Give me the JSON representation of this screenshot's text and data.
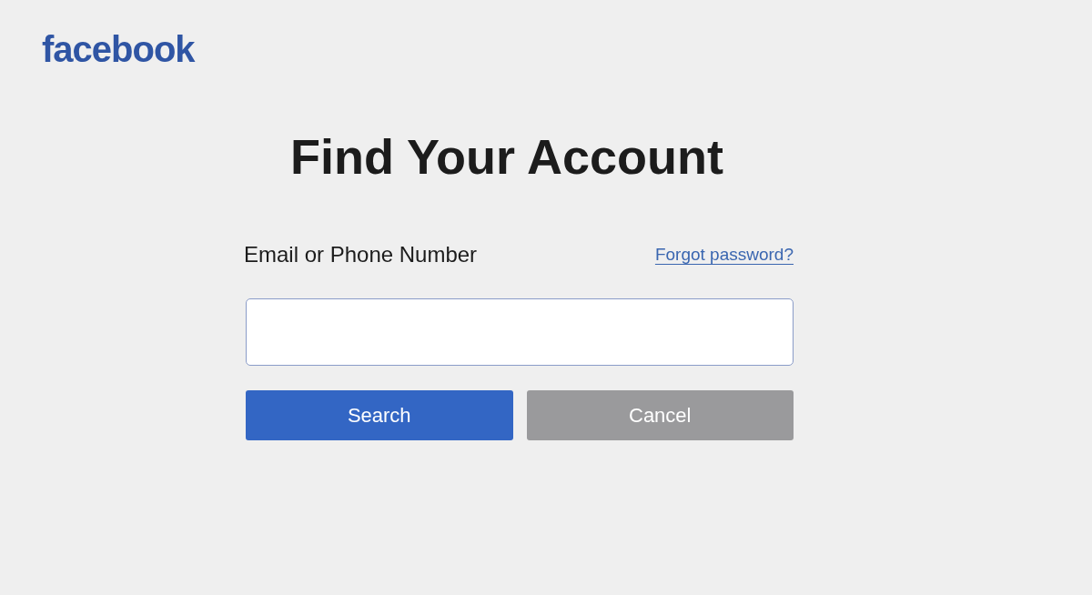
{
  "logo": "facebook",
  "title": "Find Your Account",
  "form": {
    "label": "Email or Phone Number",
    "link": "Forgot password?",
    "buttons": [
      {
        "label": "Search",
        "kind": "primary"
      },
      {
        "label": "Cancel",
        "kind": "secondary"
      }
    ]
  }
}
